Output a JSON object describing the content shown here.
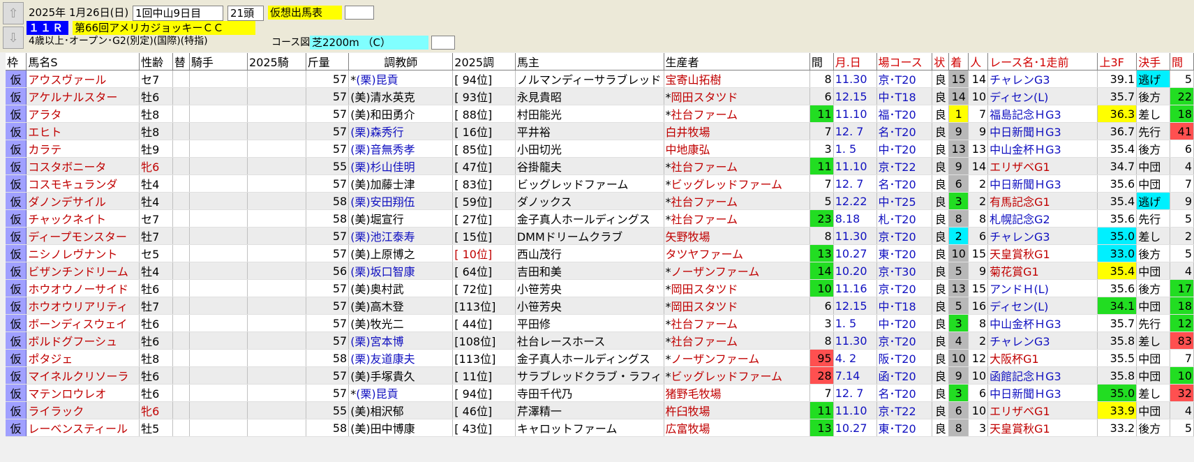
{
  "header": {
    "date": "2025年 1月26日(日)",
    "meeting": "1回中山9日目",
    "heads": "21頭",
    "mode": "仮想出馬表",
    "race_no": "１１Ｒ",
    "race_name": "第66回アメリカジョッキーＣＣ",
    "conditions": "4歳以上･オープン･G2(別定)(国際)(特指)",
    "course_label": "コース図",
    "course": "芝2200m （C）",
    "up_icon": "arrow-up-icon",
    "down_icon": "arrow-down-icon"
  },
  "columns": [
    "枠",
    "馬名S",
    "性齢",
    "替",
    "騎手",
    "2025騎",
    "斤量",
    "調教師",
    "2025調",
    "馬主",
    "生産者",
    "間",
    "月.日",
    "場コース",
    "状",
    "着",
    "人",
    "レース名･1走前",
    "上3F",
    "決手",
    "間"
  ],
  "rows": [
    {
      "waku": "仮",
      "name": "アウスヴァール",
      "sex": "セ7",
      "sexRed": false,
      "kin": "57",
      "tmark": "*",
      "trainer": "(栗)昆貢",
      "tBlue": true,
      "trank": "[ 94位]",
      "trankRed": false,
      "owner": "ノルマンディーサラブレッド",
      "omark": "",
      "breeder": "宝寄山拓樹",
      "kan": "8",
      "kanC": "",
      "date": "11.30",
      "course": "京･T20",
      "cond": "良",
      "chaku": "15",
      "chakuC": "gray",
      "nin": "14",
      "race": "チャレンG3",
      "raceRed": false,
      "f3": "39.1",
      "f3C": "",
      "kime": "逃げ",
      "kimeC": "cyan",
      "kan2": "5",
      "kan2C": ""
    },
    {
      "waku": "仮",
      "name": "アケルナルスター",
      "sex": "牡6",
      "sexRed": false,
      "kin": "57",
      "tmark": "",
      "trainer": "(美)清水英克",
      "tBlue": false,
      "trank": "[ 93位]",
      "trankRed": false,
      "owner": "永見貴昭",
      "omark": "*",
      "breeder": "岡田スタツド",
      "kan": "6",
      "kanC": "",
      "date": "12.15",
      "course": "中･T18",
      "cond": "良",
      "chaku": "14",
      "chakuC": "gray",
      "nin": "10",
      "race": "ディセン(L)",
      "raceRed": false,
      "f3": "35.7",
      "f3C": "",
      "kime": "後方",
      "kimeC": "",
      "kan2": "22",
      "kan2C": "green"
    },
    {
      "waku": "仮",
      "name": "アラタ",
      "sex": "牡8",
      "sexRed": false,
      "kin": "57",
      "tmark": "",
      "trainer": "(美)和田勇介",
      "tBlue": false,
      "trank": "[ 88位]",
      "trankRed": false,
      "owner": "村田能光",
      "omark": "*",
      "breeder": "社台ファーム",
      "kan": "11",
      "kanC": "green",
      "date": "11.10",
      "course": "福･T20",
      "cond": "良",
      "chaku": "1",
      "chakuC": "yellow",
      "nin": "7",
      "race": "福島記念ＨG3",
      "raceRed": false,
      "f3": "36.3",
      "f3C": "yellow",
      "kime": "差し",
      "kimeC": "",
      "kan2": "18",
      "kan2C": "green"
    },
    {
      "waku": "仮",
      "name": "エヒト",
      "sex": "牡8",
      "sexRed": false,
      "kin": "57",
      "tmark": "",
      "trainer": "(栗)森秀行",
      "tBlue": true,
      "trank": "[ 16位]",
      "trankRed": false,
      "owner": "平井裕",
      "omark": "",
      "breeder": "白井牧場",
      "kan": "7",
      "kanC": "",
      "date": "12. 7",
      "course": "名･T20",
      "cond": "良",
      "chaku": "9",
      "chakuC": "gray",
      "nin": "9",
      "race": "中日新聞ＨG3",
      "raceRed": false,
      "f3": "36.7",
      "f3C": "",
      "kime": "先行",
      "kimeC": "",
      "kan2": "41",
      "kan2C": "pink"
    },
    {
      "waku": "仮",
      "name": "カラテ",
      "sex": "牡9",
      "sexRed": false,
      "kin": "57",
      "tmark": "",
      "trainer": "(栗)音無秀孝",
      "tBlue": true,
      "trank": "[ 85位]",
      "trankRed": false,
      "owner": "小田切光",
      "omark": "",
      "breeder": "中地康弘",
      "kan": "3",
      "kanC": "",
      "date": "1. 5",
      "course": "中･T20",
      "cond": "良",
      "chaku": "13",
      "chakuC": "gray",
      "nin": "13",
      "race": "中山金杯ＨG3",
      "raceRed": false,
      "f3": "35.4",
      "f3C": "",
      "kime": "後方",
      "kimeC": "",
      "kan2": "6",
      "kan2C": ""
    },
    {
      "waku": "仮",
      "name": "コスタボニータ",
      "sex": "牝6",
      "sexRed": true,
      "kin": "55",
      "tmark": "",
      "trainer": "(栗)杉山佳明",
      "tBlue": true,
      "trank": "[ 47位]",
      "trankRed": false,
      "owner": "谷掛龍夫",
      "omark": "*",
      "breeder": "社台ファーム",
      "kan": "11",
      "kanC": "green",
      "date": "11.10",
      "course": "京･T22",
      "cond": "良",
      "chaku": "9",
      "chakuC": "gray",
      "nin": "14",
      "race": "エリザベG1",
      "raceRed": true,
      "f3": "34.7",
      "f3C": "",
      "kime": "中団",
      "kimeC": "",
      "kan2": "4",
      "kan2C": ""
    },
    {
      "waku": "仮",
      "name": "コスモキュランダ",
      "sex": "牡4",
      "sexRed": false,
      "kin": "57",
      "tmark": "",
      "trainer": "(美)加藤士津",
      "tBlue": false,
      "trank": "[ 83位]",
      "trankRed": false,
      "owner": "ビッグレッドファーム",
      "omark": "*",
      "breeder": "ビッグレッドファーム",
      "kan": "7",
      "kanC": "",
      "date": "12. 7",
      "course": "名･T20",
      "cond": "良",
      "chaku": "6",
      "chakuC": "gray",
      "nin": "2",
      "race": "中日新聞ＨG3",
      "raceRed": false,
      "f3": "35.6",
      "f3C": "",
      "kime": "中団",
      "kimeC": "",
      "kan2": "7",
      "kan2C": ""
    },
    {
      "waku": "仮",
      "name": "ダノンデサイル",
      "sex": "牡4",
      "sexRed": false,
      "kin": "58",
      "tmark": "",
      "trainer": "(栗)安田翔伍",
      "tBlue": true,
      "trank": "[ 59位]",
      "trankRed": false,
      "owner": "ダノックス",
      "omark": "*",
      "breeder": "社台ファーム",
      "kan": "5",
      "kanC": "",
      "date": "12.22",
      "course": "中･T25",
      "cond": "良",
      "chaku": "3",
      "chakuC": "green",
      "nin": "2",
      "race": "有馬記念G1",
      "raceRed": true,
      "f3": "35.4",
      "f3C": "",
      "kime": "逃げ",
      "kimeC": "cyan",
      "kan2": "9",
      "kan2C": ""
    },
    {
      "waku": "仮",
      "name": "チャックネイト",
      "sex": "セ7",
      "sexRed": false,
      "kin": "58",
      "tmark": "",
      "trainer": "(美)堀宣行",
      "tBlue": false,
      "trank": "[ 27位]",
      "trankRed": false,
      "owner": "金子真人ホールディングス",
      "omark": "*",
      "breeder": "社台ファーム",
      "kan": "23",
      "kanC": "green",
      "date": "8.18",
      "course": "札･T20",
      "cond": "良",
      "chaku": "8",
      "chakuC": "gray",
      "nin": "8",
      "race": "札幌記念G2",
      "raceRed": false,
      "f3": "35.6",
      "f3C": "",
      "kime": "先行",
      "kimeC": "",
      "kan2": "5",
      "kan2C": ""
    },
    {
      "waku": "仮",
      "name": "ディープモンスター",
      "sex": "牡7",
      "sexRed": false,
      "kin": "57",
      "tmark": "",
      "trainer": "(栗)池江泰寿",
      "tBlue": true,
      "trank": "[ 15位]",
      "trankRed": false,
      "owner": "DMMドリームクラブ",
      "omark": "",
      "breeder": "矢野牧場",
      "kan": "8",
      "kanC": "",
      "date": "11.30",
      "course": "京･T20",
      "cond": "良",
      "chaku": "2",
      "chakuC": "cyan",
      "nin": "6",
      "race": "チャレンG3",
      "raceRed": false,
      "f3": "35.0",
      "f3C": "cyan",
      "kime": "差し",
      "kimeC": "",
      "kan2": "2",
      "kan2C": ""
    },
    {
      "waku": "仮",
      "name": "ニシノレヴナント",
      "sex": "セ5",
      "sexRed": false,
      "kin": "57",
      "tmark": "",
      "trainer": "(美)上原博之",
      "tBlue": false,
      "trank": "[ 10位]",
      "trankRed": true,
      "owner": "西山茂行",
      "omark": "",
      "breeder": "タツヤファーム",
      "kan": "13",
      "kanC": "green",
      "date": "10.27",
      "course": "東･T20",
      "cond": "良",
      "chaku": "10",
      "chakuC": "gray",
      "nin": "15",
      "race": "天皇賞秋G1",
      "raceRed": true,
      "f3": "33.0",
      "f3C": "cyan",
      "kime": "後方",
      "kimeC": "",
      "kan2": "5",
      "kan2C": ""
    },
    {
      "waku": "仮",
      "name": "ビザンチンドリーム",
      "sex": "牡4",
      "sexRed": false,
      "kin": "56",
      "tmark": "",
      "trainer": "(栗)坂口智康",
      "tBlue": true,
      "trank": "[ 64位]",
      "trankRed": false,
      "owner": "吉田和美",
      "omark": "*",
      "breeder": "ノーザンファーム",
      "kan": "14",
      "kanC": "green",
      "date": "10.20",
      "course": "京･T30",
      "cond": "良",
      "chaku": "5",
      "chakuC": "gray",
      "nin": "9",
      "race": "菊花賞G1",
      "raceRed": true,
      "f3": "35.4",
      "f3C": "yellow",
      "kime": "中団",
      "kimeC": "",
      "kan2": "4",
      "kan2C": ""
    },
    {
      "waku": "仮",
      "name": "ホウオウノーサイド",
      "sex": "牡6",
      "sexRed": false,
      "kin": "57",
      "tmark": "",
      "trainer": "(美)奥村武",
      "tBlue": false,
      "trank": "[ 72位]",
      "trankRed": false,
      "owner": "小笹芳央",
      "omark": "*",
      "breeder": "岡田スタツド",
      "kan": "10",
      "kanC": "green",
      "date": "11.16",
      "course": "京･T20",
      "cond": "良",
      "chaku": "13",
      "chakuC": "gray",
      "nin": "15",
      "race": "アンドＨ(L)",
      "raceRed": false,
      "f3": "35.6",
      "f3C": "",
      "kime": "後方",
      "kimeC": "",
      "kan2": "17",
      "kan2C": "green"
    },
    {
      "waku": "仮",
      "name": "ホウオウリアリティ",
      "sex": "牡7",
      "sexRed": false,
      "kin": "57",
      "tmark": "",
      "trainer": "(美)高木登",
      "tBlue": false,
      "trank": "[113位]",
      "trankRed": false,
      "owner": "小笹芳央",
      "omark": "*",
      "breeder": "岡田スタツド",
      "kan": "6",
      "kanC": "",
      "date": "12.15",
      "course": "中･T18",
      "cond": "良",
      "chaku": "5",
      "chakuC": "gray",
      "nin": "16",
      "race": "ディセン(L)",
      "raceRed": false,
      "f3": "34.1",
      "f3C": "green",
      "kime": "中団",
      "kimeC": "",
      "kan2": "18",
      "kan2C": "green"
    },
    {
      "waku": "仮",
      "name": "ボーンディスウェイ",
      "sex": "牡6",
      "sexRed": false,
      "kin": "57",
      "tmark": "",
      "trainer": "(美)牧光二",
      "tBlue": false,
      "trank": "[ 44位]",
      "trankRed": false,
      "owner": "平田修",
      "omark": "*",
      "breeder": "社台ファーム",
      "kan": "3",
      "kanC": "",
      "date": "1. 5",
      "course": "中･T20",
      "cond": "良",
      "chaku": "3",
      "chakuC": "green",
      "nin": "8",
      "race": "中山金杯ＨG3",
      "raceRed": false,
      "f3": "35.7",
      "f3C": "",
      "kime": "先行",
      "kimeC": "",
      "kan2": "12",
      "kan2C": "green"
    },
    {
      "waku": "仮",
      "name": "ボルドグフーシュ",
      "sex": "牡6",
      "sexRed": false,
      "kin": "57",
      "tmark": "",
      "trainer": "(栗)宮本博",
      "tBlue": true,
      "trank": "[108位]",
      "trankRed": false,
      "owner": "社台レースホース",
      "omark": "*",
      "breeder": "社台ファーム",
      "kan": "8",
      "kanC": "",
      "date": "11.30",
      "course": "京･T20",
      "cond": "良",
      "chaku": "4",
      "chakuC": "gray",
      "nin": "2",
      "race": "チャレンG3",
      "raceRed": false,
      "f3": "35.8",
      "f3C": "",
      "kime": "差し",
      "kimeC": "",
      "kan2": "83",
      "kan2C": "pink"
    },
    {
      "waku": "仮",
      "name": "ポタジェ",
      "sex": "牡8",
      "sexRed": false,
      "kin": "58",
      "tmark": "",
      "trainer": "(栗)友道康夫",
      "tBlue": true,
      "trank": "[113位]",
      "trankRed": false,
      "owner": "金子真人ホールディングス",
      "omark": "*",
      "breeder": "ノーザンファーム",
      "kan": "95",
      "kanC": "pink",
      "date": "4. 2",
      "course": "阪･T20",
      "cond": "良",
      "chaku": "10",
      "chakuC": "gray",
      "nin": "12",
      "race": "大阪杯G1",
      "raceRed": true,
      "f3": "35.5",
      "f3C": "",
      "kime": "中団",
      "kimeC": "",
      "kan2": "7",
      "kan2C": ""
    },
    {
      "waku": "仮",
      "name": "マイネルクリソーラ",
      "sex": "牡6",
      "sexRed": false,
      "kin": "57",
      "tmark": "",
      "trainer": "(美)手塚貴久",
      "tBlue": false,
      "trank": "[ 11位]",
      "trankRed": false,
      "owner": "サラブレッドクラブ・ラフィ",
      "omark": "*",
      "breeder": "ビッグレッドファーム",
      "kan": "28",
      "kanC": "pink",
      "date": "7.14",
      "course": "函･T20",
      "cond": "良",
      "chaku": "9",
      "chakuC": "gray",
      "nin": "10",
      "race": "函館記念ＨG3",
      "raceRed": false,
      "f3": "35.8",
      "f3C": "",
      "kime": "中団",
      "kimeC": "",
      "kan2": "10",
      "kan2C": "green"
    },
    {
      "waku": "仮",
      "name": "マテンロウレオ",
      "sex": "牡6",
      "sexRed": false,
      "kin": "57",
      "tmark": "*",
      "trainer": "(栗)昆貢",
      "tBlue": true,
      "trank": "[ 94位]",
      "trankRed": false,
      "owner": "寺田千代乃",
      "omark": "",
      "breeder": "猪野毛牧場",
      "kan": "7",
      "kanC": "",
      "date": "12. 7",
      "course": "名･T20",
      "cond": "良",
      "chaku": "3",
      "chakuC": "green",
      "nin": "6",
      "race": "中日新聞ＨG3",
      "raceRed": false,
      "f3": "35.0",
      "f3C": "green",
      "kime": "差し",
      "kimeC": "",
      "kan2": "32",
      "kan2C": "pink"
    },
    {
      "waku": "仮",
      "name": "ライラック",
      "sex": "牝6",
      "sexRed": true,
      "kin": "55",
      "tmark": "",
      "trainer": "(美)相沢郁",
      "tBlue": false,
      "trank": "[ 46位]",
      "trankRed": false,
      "owner": "芹澤精一",
      "omark": "",
      "breeder": "杵臼牧場",
      "kan": "11",
      "kanC": "green",
      "date": "11.10",
      "course": "京･T22",
      "cond": "良",
      "chaku": "6",
      "chakuC": "gray",
      "nin": "10",
      "race": "エリザベG1",
      "raceRed": true,
      "f3": "33.9",
      "f3C": "yellow",
      "kime": "中団",
      "kimeC": "",
      "kan2": "4",
      "kan2C": ""
    },
    {
      "waku": "仮",
      "name": "レーベンスティール",
      "sex": "牡5",
      "sexRed": false,
      "kin": "58",
      "tmark": "",
      "trainer": "(美)田中博康",
      "tBlue": false,
      "trank": "[ 43位]",
      "trankRed": false,
      "owner": "キャロットファーム",
      "omark": "",
      "breeder": "広富牧場",
      "kan": "13",
      "kanC": "green",
      "date": "10.27",
      "course": "東･T20",
      "cond": "良",
      "chaku": "8",
      "chakuC": "gray",
      "nin": "3",
      "race": "天皇賞秋G1",
      "raceRed": true,
      "f3": "33.2",
      "f3C": "",
      "kime": "後方",
      "kimeC": "",
      "kan2": "5",
      "kan2C": ""
    }
  ]
}
